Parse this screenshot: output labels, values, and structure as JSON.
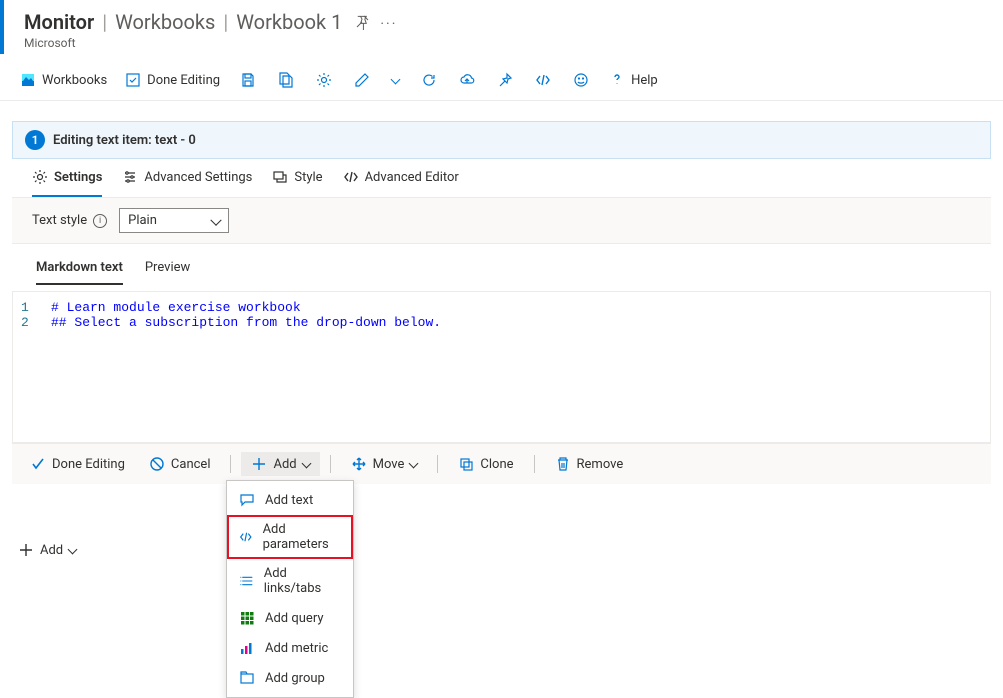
{
  "header": {
    "breadcrumb": {
      "part1": "Monitor",
      "part2": "Workbooks",
      "part3": "Workbook 1"
    },
    "subtitle": "Microsoft"
  },
  "topToolbar": {
    "workbooks": "Workbooks",
    "doneEditing": "Done Editing",
    "help": "Help"
  },
  "step": {
    "number": "1",
    "text": "Editing text item: text - 0"
  },
  "innerTabs": {
    "settings": "Settings",
    "advancedSettings": "Advanced Settings",
    "style": "Style",
    "advancedEditor": "Advanced Editor"
  },
  "styleRow": {
    "label": "Text style",
    "selected": "Plain"
  },
  "mdTabs": {
    "markdown": "Markdown text",
    "preview": "Preview"
  },
  "markdownContent": "# Learn module exercise workbook\n## Select a subscription from the drop-down below.",
  "itemToolbar": {
    "doneEditing": "Done Editing",
    "cancel": "Cancel",
    "add": "Add",
    "move": "Move",
    "clone": "Clone",
    "remove": "Remove"
  },
  "dropdown": {
    "addText": "Add text",
    "addParameters": "Add parameters",
    "addLinksTabs": "Add links/tabs",
    "addQuery": "Add query",
    "addMetric": "Add metric",
    "addGroup": "Add group"
  },
  "pageAdd": "Add"
}
